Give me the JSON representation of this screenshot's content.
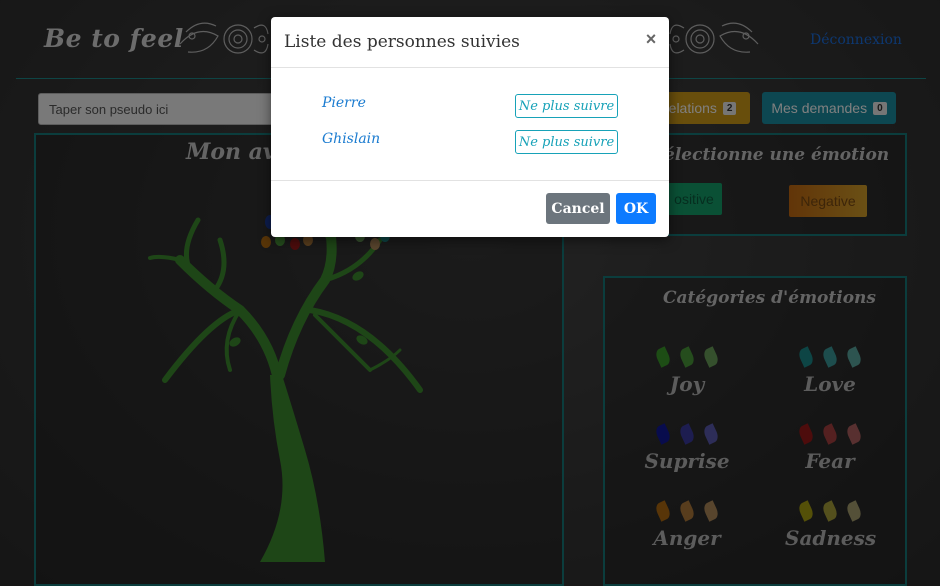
{
  "header": {
    "logo": "Be to feel",
    "logout_label": "Déconnexion"
  },
  "toolbar": {
    "search_placeholder": "Taper son pseudo ici",
    "relations_label": "relations",
    "relations_count": "2",
    "demandes_label": "Mes demandes",
    "demandes_count": "0"
  },
  "avatar_panel": {
    "title": "Mon ava"
  },
  "emotion_panel": {
    "title": "électionne une émotion",
    "positive_label": "ositive",
    "negative_label": "Negative"
  },
  "categories_panel": {
    "title": "Catégories d'émotions",
    "items": [
      {
        "label": "Joy",
        "colors": [
          "#3a9a2a",
          "#4a9a3a",
          "#6aa05a"
        ]
      },
      {
        "label": "Love",
        "colors": [
          "#1a8a8a",
          "#3a9a9a",
          "#5aa8a0"
        ]
      },
      {
        "label": "Suprise",
        "colors": [
          "#10189a",
          "#3a3aa0",
          "#5a5ab0"
        ]
      },
      {
        "label": "Fear",
        "colors": [
          "#9a1818",
          "#a84040",
          "#b06060"
        ]
      },
      {
        "label": "Anger",
        "colors": [
          "#b06a10",
          "#b07a3a",
          "#b08a5a"
        ]
      },
      {
        "label": "Sadness",
        "colors": [
          "#a8a010",
          "#a8a03a",
          "#a8a070"
        ]
      }
    ]
  },
  "colors": {
    "accent_teal": "#177a7a",
    "tree_green": "#3d8c2e"
  },
  "modal": {
    "title": "Liste des personnes suivies",
    "close_glyph": "×",
    "followed": [
      {
        "name": "Pierre",
        "action": "Ne plus suivre"
      },
      {
        "name": "Ghislain",
        "action": "Ne plus suivre"
      }
    ],
    "cancel_label": "Cancel",
    "ok_label": "OK"
  }
}
